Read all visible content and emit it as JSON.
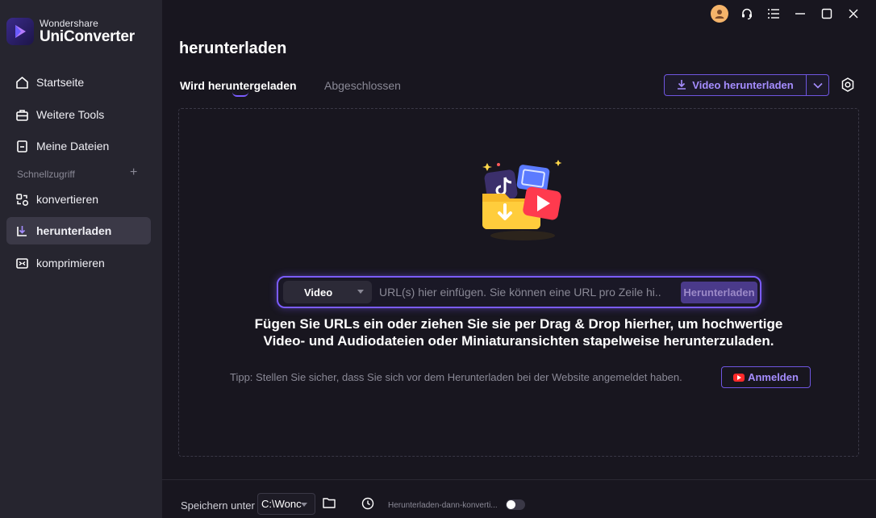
{
  "app": {
    "brand_small": "Wondershare",
    "brand_big": "UniConverter"
  },
  "sidebar": {
    "items": [
      {
        "label": "Startseite",
        "icon": "home-icon"
      },
      {
        "label": "Weitere Tools",
        "icon": "toolbox-icon"
      },
      {
        "label": "Meine Dateien",
        "icon": "file-icon"
      }
    ],
    "section_label": "Schnellzugriff",
    "quick": [
      {
        "label": "konvertieren",
        "icon": "convert-icon"
      },
      {
        "label": "herunterladen",
        "icon": "download-icon",
        "active": true
      },
      {
        "label": "komprimieren",
        "icon": "compress-icon"
      }
    ]
  },
  "main": {
    "title": "herunterladen",
    "tabs": [
      {
        "label": "Wird heruntergeladen",
        "active": true
      },
      {
        "label": "Abgeschlossen",
        "active": false
      }
    ],
    "download_button": "Video herunterladen",
    "url_bar": {
      "type_value": "Video",
      "placeholder": "URL(s) hier einfügen. Sie können eine URL pro Zeile hi...",
      "submit_label": "Herunterladen"
    },
    "message_line1": "Fügen Sie URLs ein oder ziehen Sie sie per Drag & Drop hierher, um hochwertige",
    "message_line2": "Video- und Audiodateien oder Miniaturansichten stapelweise herunterzuladen.",
    "tip": "Tipp: Stellen Sie sicher, dass Sie sich vor dem Herunterladen bei der Website angemeldet haben.",
    "signin_label": "Anmelden"
  },
  "bottom": {
    "save_label": "Speichern unter",
    "path_value": "C:\\Wonc",
    "convert_label": "Herunterladen-dann-konverti...",
    "toggle_on": false
  },
  "colors": {
    "accent": "#7b5cff",
    "sidebar_bg": "#26252f",
    "main_bg": "#18161f"
  }
}
